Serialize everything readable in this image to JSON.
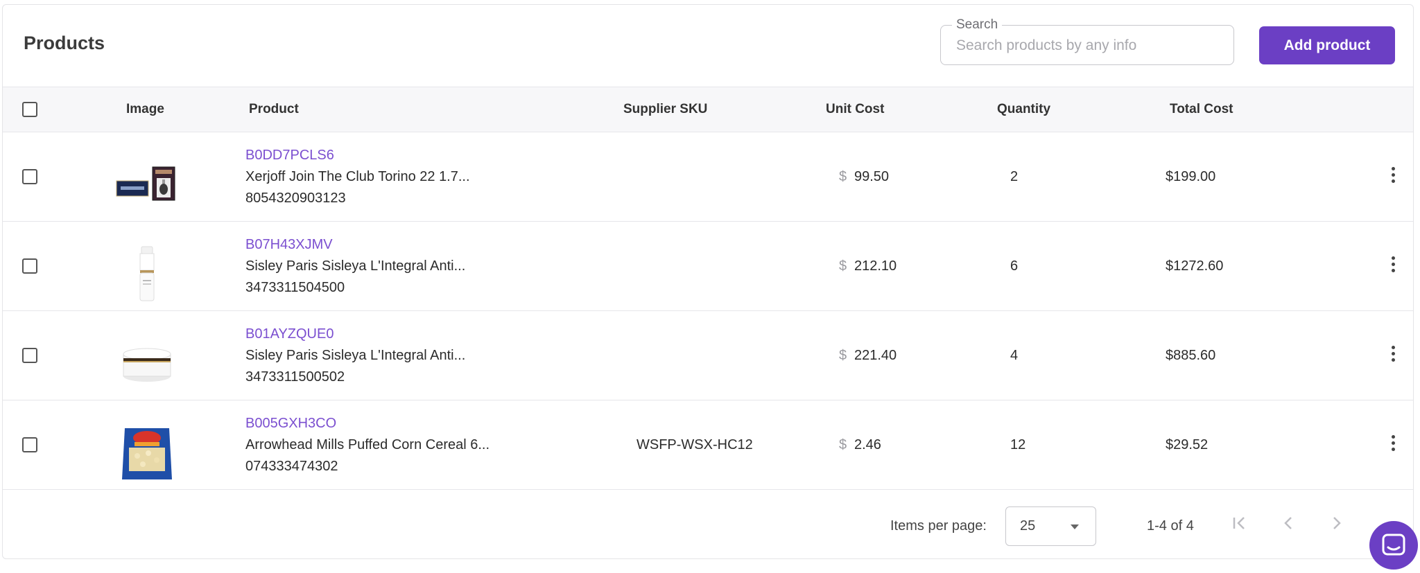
{
  "header": {
    "title": "Products",
    "search_label": "Search",
    "search_placeholder": "Search products by any info",
    "search_value": "",
    "add_button": "Add product"
  },
  "columns": {
    "image": "Image",
    "product": "Product",
    "supplier_sku": "Supplier SKU",
    "unit_cost": "Unit Cost",
    "quantity": "Quantity",
    "total_cost": "Total Cost"
  },
  "rows": [
    {
      "asin": "B0DD7PCLS6",
      "name": "Xerjoff Join The Club Torino 22 1.7...",
      "code": "8054320903123",
      "supplier_sku": "",
      "currency": "$",
      "unit_cost": "99.50",
      "quantity": "2",
      "total_cost": "$199.00",
      "image_icon": "perfume-box-image"
    },
    {
      "asin": "B07H43XJMV",
      "name": "Sisley Paris Sisleya L'Integral Anti...",
      "code": "3473311504500",
      "supplier_sku": "",
      "currency": "$",
      "unit_cost": "212.10",
      "quantity": "6",
      "total_cost": "$1272.60",
      "image_icon": "serum-bottle-image"
    },
    {
      "asin": "B01AYZQUE0",
      "name": "Sisley Paris Sisleya L'Integral Anti...",
      "code": "3473311500502",
      "supplier_sku": "",
      "currency": "$",
      "unit_cost": "221.40",
      "quantity": "4",
      "total_cost": "$885.60",
      "image_icon": "cream-jar-image"
    },
    {
      "asin": "B005GXH3CO",
      "name": "Arrowhead Mills Puffed Corn Cereal 6...",
      "code": "074333474302",
      "supplier_sku": "WSFP-WSX-HC12",
      "currency": "$",
      "unit_cost": "2.46",
      "quantity": "12",
      "total_cost": "$29.52",
      "image_icon": "cereal-bag-image"
    }
  ],
  "footer": {
    "items_per_page_label": "Items per page:",
    "items_per_page_value": "25",
    "range_text": "1-4 of 4"
  },
  "colors": {
    "accent": "#6b3fc4",
    "link": "#7b4fd0",
    "header_bg": "#f7f7f9",
    "border": "#e6e6ea"
  }
}
